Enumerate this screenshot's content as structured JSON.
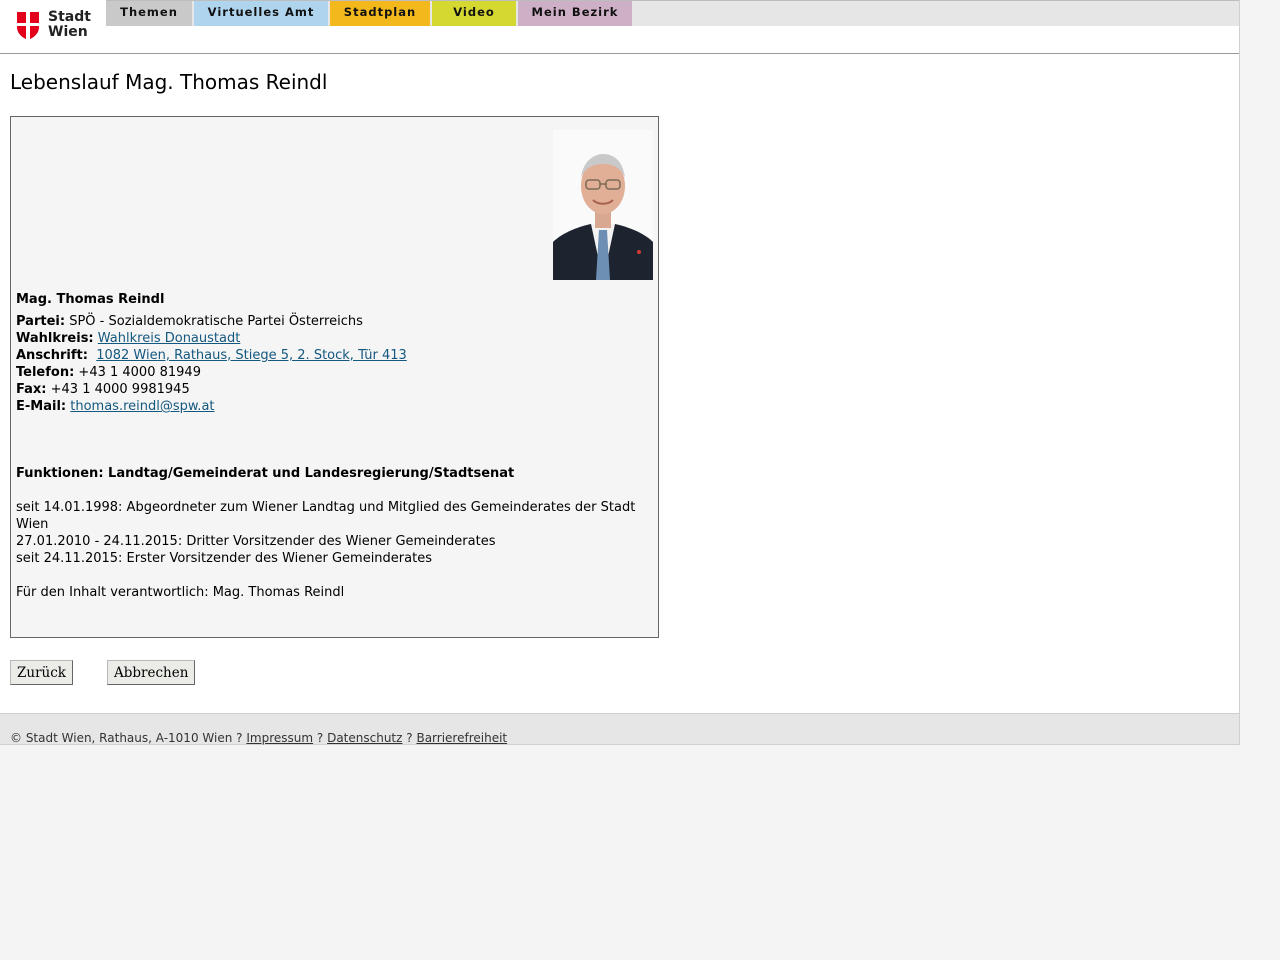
{
  "header": {
    "logo_text_line1": "Stadt",
    "logo_text_line2": "Wien",
    "tabs": [
      {
        "label": "Themen",
        "color": "#c9c9c9",
        "width": 86
      },
      {
        "label": "Virtuelles Amt",
        "color": "#aed4ee",
        "width": 134
      },
      {
        "label": "Stadtplan",
        "color": "#f2b81c",
        "width": 100
      },
      {
        "label": "Video",
        "color": "#d4d830",
        "width": 84
      },
      {
        "label": "Mein Bezirk",
        "color": "#cdafc6",
        "width": 114
      }
    ]
  },
  "page": {
    "title": "Lebenslauf Mag. Thomas Reindl"
  },
  "profile": {
    "name": "Mag. Thomas Reindl",
    "partei_label": "Partei:",
    "partei_value": "SPÖ - Sozialdemokratische Partei Österreichs",
    "wahlkreis_label": "Wahlkreis:",
    "wahlkreis_value": "Wahlkreis Donaustadt",
    "anschrift_label": "Anschrift:",
    "anschrift_value": "1082 Wien, Rathaus, Stiege 5, 2. Stock, Tür 413",
    "telefon_label": "Telefon:",
    "telefon_value": "+43 1 4000 81949",
    "fax_label": "Fax:",
    "fax_value": "+43 1 4000 9981945",
    "email_label": "E-Mail:",
    "email_value": "thomas.reindl@spw.at"
  },
  "functions": {
    "heading": "Funktionen: Landtag/Gemeinderat und Landesregierung/Stadtsenat",
    "items": [
      "seit 14.01.1998: Abgeordneter zum Wiener Landtag und Mitglied des Gemeinderates der Stadt Wien",
      "27.01.2010 - 24.11.2015: Dritter Vorsitzender des Wiener Gemeinderates",
      "seit 24.11.2015: Erster Vorsitzender des Wiener Gemeinderates"
    ],
    "responsible": "Für den Inhalt verantwortlich: Mag. Thomas Reindl"
  },
  "buttons": {
    "back": "Zurück",
    "cancel": "Abbrechen"
  },
  "footer": {
    "copyright": "© Stadt Wien, Rathaus, A-1010 Wien",
    "sep": "?",
    "impressum": "Impressum",
    "datenschutz": "Datenschutz",
    "barrierefreiheit": "Barrierefreiheit"
  },
  "colors": {
    "link": "#14587f",
    "logo_red": "#e2001a"
  }
}
